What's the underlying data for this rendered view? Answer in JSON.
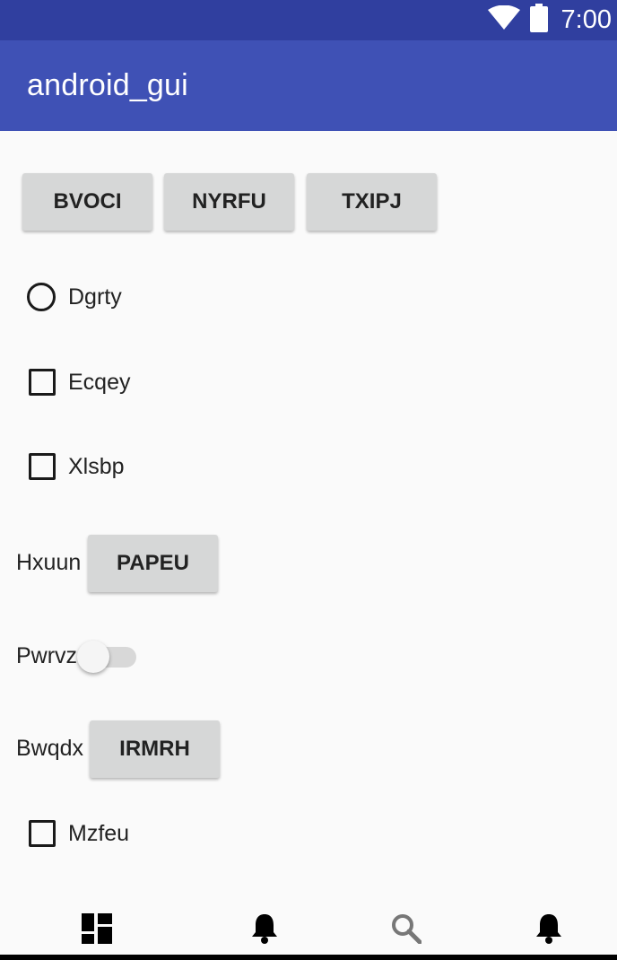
{
  "status_bar": {
    "time": "7:00",
    "icons": [
      "wifi-icon",
      "battery-icon"
    ]
  },
  "app_bar": {
    "title": "android_gui"
  },
  "top_buttons": [
    "BVOCI",
    "NYRFU",
    "TXIPJ"
  ],
  "radio_dgrty": {
    "label": "Dgrty",
    "checked": false
  },
  "checkbox_ecqey": {
    "label": "Ecqey",
    "checked": false
  },
  "checkbox_xlsbp": {
    "label": "Xlsbp",
    "checked": false
  },
  "row_hxuun": {
    "label": "Hxuun",
    "button": "PAPEU"
  },
  "row_pwrvz": {
    "label": "Pwrvz",
    "switch_on": false
  },
  "row_bwqdx": {
    "label": "Bwqdx",
    "button": "IRMRH"
  },
  "checkbox_mzfeu": {
    "label": "Mzfeu",
    "checked": false
  },
  "bottom_nav": {
    "icons": [
      "dashboard-icon",
      "notifications-icon",
      "search-icon",
      "notifications-icon"
    ]
  },
  "colors": {
    "status_bar": "#303f9f",
    "app_bar": "#3f51b5",
    "background": "#fafafa",
    "button": "#d6d7d7"
  }
}
